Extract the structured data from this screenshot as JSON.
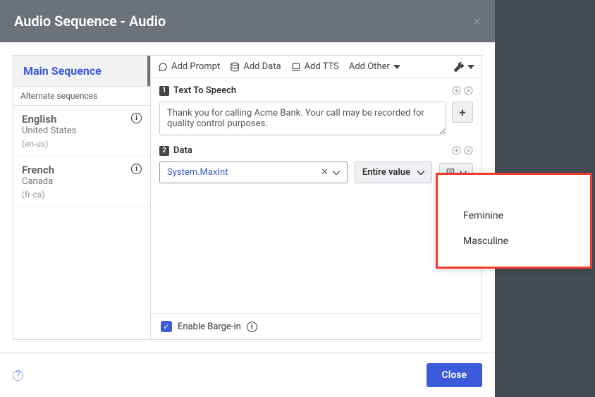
{
  "header": {
    "title": "Audio Sequence - Audio"
  },
  "sidebar": {
    "mainSequence": "Main Sequence",
    "altLabel": "Alternate sequences",
    "languages": [
      {
        "name": "English",
        "region": "United States",
        "code": "(en-us)"
      },
      {
        "name": "French",
        "region": "Canada",
        "code": "(fr-ca)"
      }
    ]
  },
  "toolbar": {
    "addPrompt": "Add Prompt",
    "addData": "Add Data",
    "addTTS": "Add TTS",
    "addOther": "Add Other"
  },
  "sections": {
    "tts": {
      "num": "1",
      "label": "Text To Speech",
      "text": "Thank you for calling Acme Bank. Your call may be recorded for quality control purposes."
    },
    "data": {
      "num": "2",
      "label": "Data",
      "value": "System.MaxInt",
      "entireValue": "Entire value"
    }
  },
  "bargeIn": {
    "label": "Enable Barge-in"
  },
  "footer": {
    "close": "Close"
  },
  "dropdown": {
    "items": [
      "Feminine",
      "Masculine"
    ]
  }
}
